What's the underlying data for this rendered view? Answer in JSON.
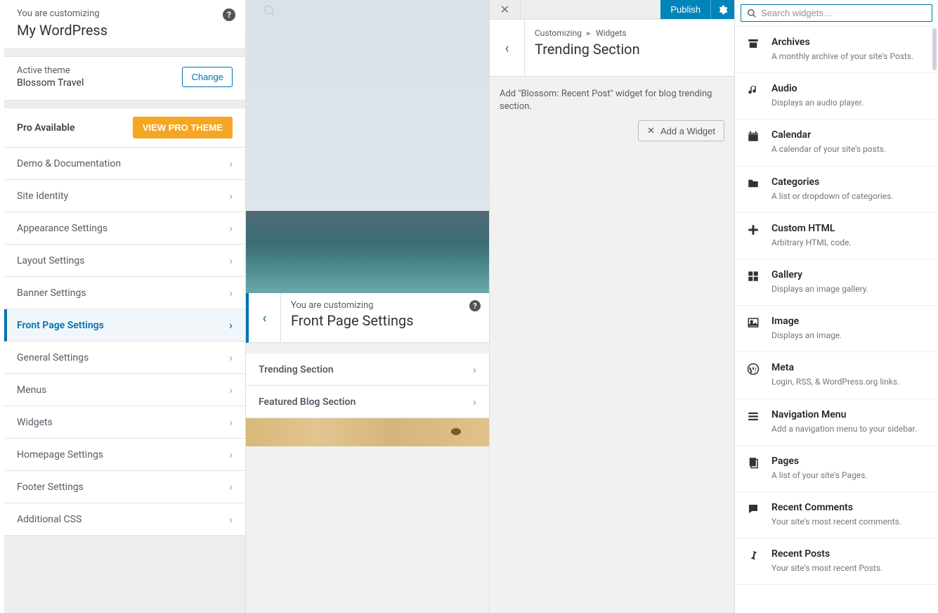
{
  "panel1": {
    "subtitle": "You are customizing",
    "title": "My WordPress",
    "theme_label": "Active theme",
    "theme_name": "Blossom Travel",
    "change_btn": "Change",
    "pro_text": "Pro Available",
    "pro_btn": "VIEW PRO THEME",
    "items": [
      "Demo & Documentation",
      "Site Identity",
      "Appearance Settings",
      "Layout Settings",
      "Banner Settings",
      "Front Page Settings",
      "General Settings",
      "Menus",
      "Widgets",
      "Homepage Settings",
      "Footer Settings",
      "Additional CSS"
    ],
    "active_index": 5
  },
  "panel2": {
    "subtitle": "You are customizing",
    "title": "Front Page Settings",
    "items": [
      "Trending Section",
      "Featured Blog Section"
    ]
  },
  "panel3": {
    "publish": "Publish",
    "crumb1": "Customizing",
    "crumb2": "Widgets",
    "title": "Trending Section",
    "description": "Add \"Blossom: Recent Post\" widget for blog trending section.",
    "add_btn": "Add a Widget"
  },
  "panel4": {
    "search_placeholder": "Search widgets…",
    "widgets": [
      {
        "name": "Archives",
        "desc": "A monthly archive of your site's Posts.",
        "icon": "archive"
      },
      {
        "name": "Audio",
        "desc": "Displays an audio player.",
        "icon": "audio"
      },
      {
        "name": "Calendar",
        "desc": "A calendar of your site's posts.",
        "icon": "calendar"
      },
      {
        "name": "Categories",
        "desc": "A list or dropdown of categories.",
        "icon": "folder"
      },
      {
        "name": "Custom HTML",
        "desc": "Arbitrary HTML code.",
        "icon": "plus"
      },
      {
        "name": "Gallery",
        "desc": "Displays an image gallery.",
        "icon": "gallery"
      },
      {
        "name": "Image",
        "desc": "Displays an image.",
        "icon": "image"
      },
      {
        "name": "Meta",
        "desc": "Login, RSS, & WordPress.org links.",
        "icon": "wp"
      },
      {
        "name": "Navigation Menu",
        "desc": "Add a navigation menu to your sidebar.",
        "icon": "menu"
      },
      {
        "name": "Pages",
        "desc": "A list of your site's Pages.",
        "icon": "pages"
      },
      {
        "name": "Recent Comments",
        "desc": "Your site's most recent comments.",
        "icon": "comment"
      },
      {
        "name": "Recent Posts",
        "desc": "Your site's most recent Posts.",
        "icon": "pin"
      }
    ]
  }
}
